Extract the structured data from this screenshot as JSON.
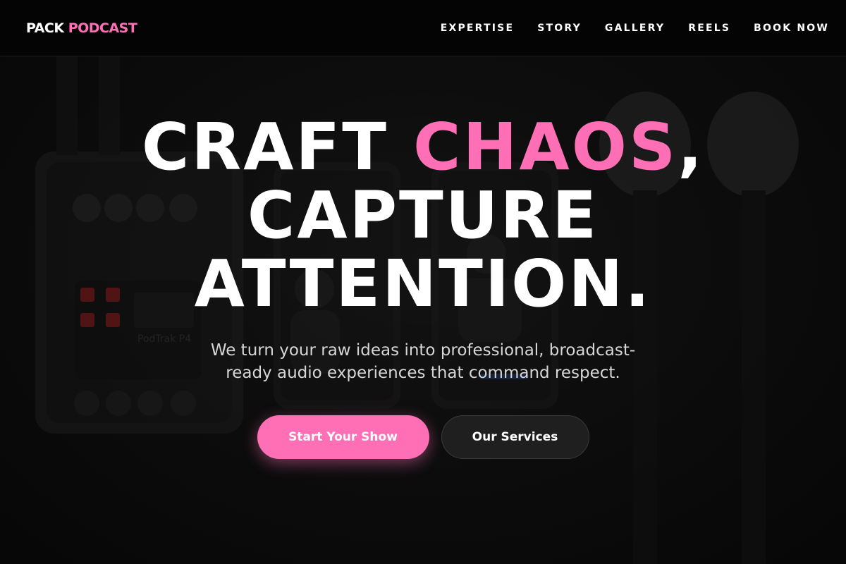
{
  "brand": {
    "name": "PACK",
    "accent": "PODCAST",
    "accent_color": "#ff6fb5"
  },
  "nav": {
    "items": [
      {
        "label": "EXPERTISE"
      },
      {
        "label": "STORY"
      },
      {
        "label": "GALLERY"
      },
      {
        "label": "REELS"
      },
      {
        "label": "BOOK NOW"
      }
    ]
  },
  "hero": {
    "headline_part1": "CRAFT ",
    "headline_highlight": "CHAOS",
    "headline_part2": ",",
    "headline_line2": "CAPTURE",
    "headline_line3": "ATTENTION.",
    "subtitle": "We turn your raw ideas into professional, broadcast-ready audio experiences that command respect.",
    "primary_cta": "Start Your Show",
    "secondary_cta": "Our Services",
    "background_device_label": "PodTrak P4"
  }
}
